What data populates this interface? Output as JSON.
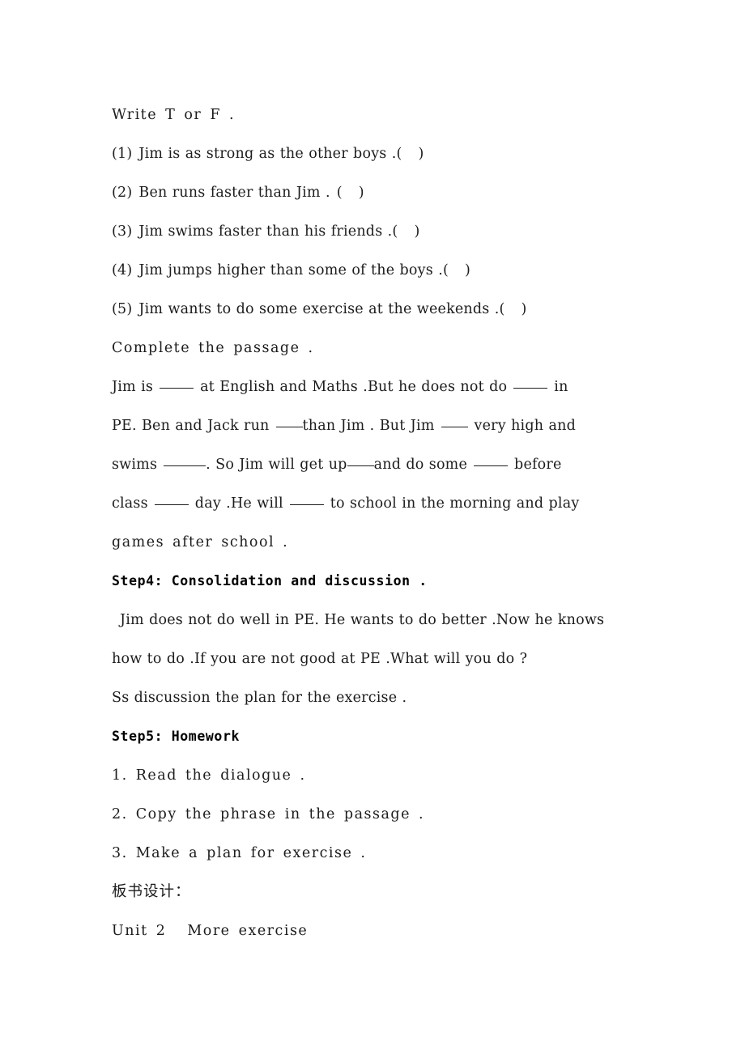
{
  "document": {
    "type": "lesson-plan-worksheet",
    "language": "en-CN",
    "background_color": "#ffffff",
    "text_color": "#1c1c1c"
  },
  "sections": {
    "true_false": {
      "instruction": "Write T or F .",
      "items": [
        {
          "number": "(1)",
          "text": "Jim is as strong as the other boys .",
          "answer_paren_open": "(",
          "answer_paren_close": ")"
        },
        {
          "number": "(2)",
          "text": "Ben runs faster than Jim .",
          "answer_paren_open": "(",
          "answer_paren_close": ")"
        },
        {
          "number": "(3)",
          "text": "Jim swims faster than his friends .",
          "answer_paren_open": "(",
          "answer_paren_close": ")"
        },
        {
          "number": "(4)",
          "text": "Jim jumps higher than some of the boys .",
          "answer_paren_open": "(",
          "answer_paren_close": ")"
        },
        {
          "number": "(5)",
          "text": "Jim wants to do some exercise at the weekends .",
          "answer_paren_open": "(",
          "answer_paren_close": ")"
        }
      ]
    },
    "complete_passage": {
      "instruction": "Complete the passage .",
      "lines": {
        "l1a": "Jim is",
        "l1b": "at English and Maths .But he does not do",
        "l1c": "in",
        "l2a": "PE. Ben and Jack run",
        "l2b": "than Jim . But Jim",
        "l2c": "very high and",
        "l3a": "swims",
        "l3b": ". So Jim will get up",
        "l3c": "and do some",
        "l3d": "before",
        "l4a": "class",
        "l4b": "day .He will",
        "l4c": "to school in the morning and play",
        "l5": "games after school ."
      }
    },
    "step4": {
      "heading": "Step4: Consolidation and discussion .",
      "paragraph_line_1": "Jim does not do well in PE. He wants to do better .Now he knows",
      "paragraph_line_2": "how to do .If you are not good at PE .What will you do ?",
      "paragraph_line_3": "Ss discussion the plan for the exercise ."
    },
    "step5": {
      "heading": "Step5: Homework",
      "items": [
        "1. Read the dialogue .",
        "2. Copy the phrase in the passage .",
        "3. Make a plan for exercise ."
      ]
    },
    "blackboard_design": {
      "heading": "板书设计：",
      "unit_line": "Unit 2",
      "unit_title": "More exercise"
    }
  }
}
